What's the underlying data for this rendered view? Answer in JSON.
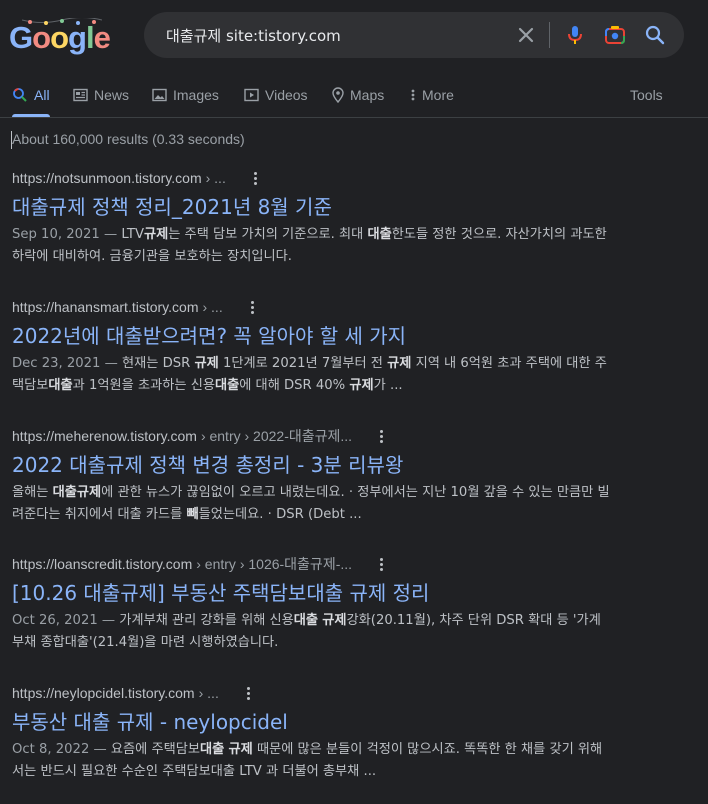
{
  "logo": {
    "letters": [
      "G",
      "o",
      "o",
      "g",
      "l",
      "e"
    ]
  },
  "search": {
    "query": "대출규제 site:tistory.com",
    "clear_icon": "close-icon",
    "voice_icon": "microphone-icon",
    "lens_icon": "camera-icon",
    "search_icon": "search-icon"
  },
  "tabs": [
    {
      "label": "All",
      "icon": "search-icon",
      "active": true
    },
    {
      "label": "News",
      "icon": "newspaper-icon"
    },
    {
      "label": "Images",
      "icon": "image-icon"
    },
    {
      "label": "Videos",
      "icon": "play-icon"
    },
    {
      "label": "Maps",
      "icon": "map-pin-icon"
    },
    {
      "label": "More",
      "icon": "more-vertical-icon"
    }
  ],
  "tools_label": "Tools",
  "result_stats": "About 160,000 results (0.33 seconds)",
  "results": [
    {
      "url": "https://notsunmoon.tistory.com",
      "path": "› ...",
      "title": "대출규제 정책 정리_2021년 8월 기준",
      "date": "Sep 10, 2021",
      "snippet": [
        [
          "LTV",
          false
        ],
        [
          "규제",
          true
        ],
        [
          "는 주택 담보 가치의 기준으로. 최대 ",
          false
        ],
        [
          "대출",
          true
        ],
        [
          "한도들 정한 것으로. 자산가치의 과도한 하락에 대비하여. 금융기관을 보호하는 장치입니다.",
          false
        ]
      ]
    },
    {
      "url": "https://hanansmart.tistory.com",
      "path": "› ...",
      "title": "2022년에 대출받으려면? 꼭 알아야 할 세 가지",
      "date": "Dec 23, 2021",
      "snippet": [
        [
          "현재는 DSR ",
          false
        ],
        [
          "규제",
          true
        ],
        [
          " 1단계로 2021년 7월부터 전 ",
          false
        ],
        [
          "규제",
          true
        ],
        [
          " 지역 내 6억원 초과 주택에 대한 주택담보",
          false
        ],
        [
          "대출",
          true
        ],
        [
          "과 1억원을 초과하는 신용",
          false
        ],
        [
          "대출",
          true
        ],
        [
          "에 대해 DSR 40% ",
          false
        ],
        [
          "규제",
          true
        ],
        [
          "가 ...",
          false
        ]
      ]
    },
    {
      "url": "https://meherenow.tistory.com",
      "path": "› entry › 2022-대출규제...",
      "title": "2022 대출규제 정책 변경 총정리 - 3분 리뷰왕",
      "date": "",
      "snippet": [
        [
          "올해는 ",
          false
        ],
        [
          "대출규제",
          true
        ],
        [
          "에 관한 뉴스가 끊임없이 오르고 내렸는데요. · 정부에서는 지난 10월 갚을 수 있는 만큼만 빌려준다는 취지에서 대출 카드를 ",
          false
        ],
        [
          "빼",
          true
        ],
        [
          "들었는데요. · DSR (Debt ...",
          false
        ]
      ]
    },
    {
      "url": "https://loanscredit.tistory.com",
      "path": "› entry › 1026-대출규제-...",
      "title": "[10.26 대출규제] 부동산 주택담보대출 규제 정리",
      "date": "Oct 26, 2021",
      "snippet": [
        [
          "가계부채 관리 강화를 위해 신용",
          false
        ],
        [
          "대출",
          true
        ],
        [
          " ",
          false
        ],
        [
          "규제",
          true
        ],
        [
          "강화(20.11월), 차주 단위 DSR 확대 등 '가계부채 종합대출'(21.4월)을 마련 시행하였습니다.",
          false
        ]
      ]
    },
    {
      "url": "https://neylopcidel.tistory.com",
      "path": "› ...",
      "title": "부동산 대출 규제 - neylopcidel",
      "date": "Oct 8, 2022",
      "snippet": [
        [
          "요즘에 주택담보",
          false
        ],
        [
          "대출",
          true
        ],
        [
          " ",
          false
        ],
        [
          "규제",
          true
        ],
        [
          " 때문에 많은 분들이 걱정이 많으시죠. 똑똑한 한 채를 갖기 위해서는 반드시 필요한 수순인 주택담보대출 LTV 과 더불어 총부채 ...",
          false
        ]
      ]
    }
  ],
  "colors": {
    "background": "#202124",
    "link": "#8ab4f8",
    "text": "#bdc1c6",
    "muted": "#9aa0a6",
    "searchbox": "#303134"
  }
}
